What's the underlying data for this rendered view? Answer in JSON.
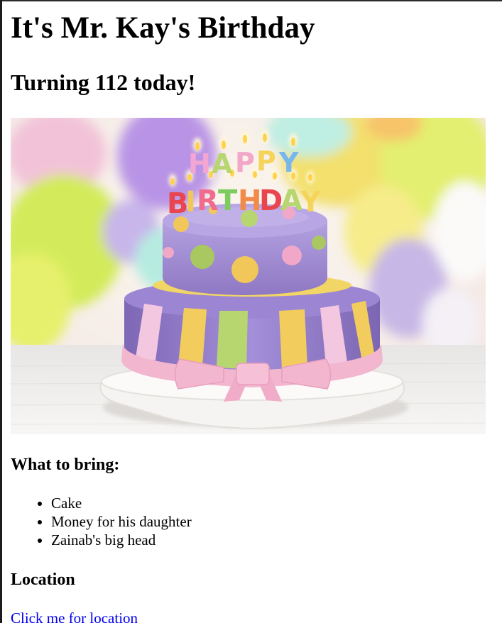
{
  "page": {
    "title": "It's Mr. Kay's Birthday",
    "subtitle": "Turning 112 today!"
  },
  "image": {
    "alt": "Happy Birthday cake with balloons",
    "candle_letters": "HAPPY BIRTHDAY",
    "colors": {
      "cake_purple": "#a38fd1",
      "ribbon_pink": "#f3b6cf",
      "stripe_yellow": "#f2cd5e",
      "stripe_green": "#b7d66f",
      "plate": "#f4f1ee"
    }
  },
  "bring": {
    "heading": "What to bring:",
    "items": [
      "Cake",
      "Money for his daughter",
      "Zainab's big head"
    ]
  },
  "location": {
    "heading": "Location",
    "link_text": "Click me for location"
  },
  "colors": {
    "link": "#0000ee",
    "text": "#000000",
    "background": "#ffffff"
  }
}
